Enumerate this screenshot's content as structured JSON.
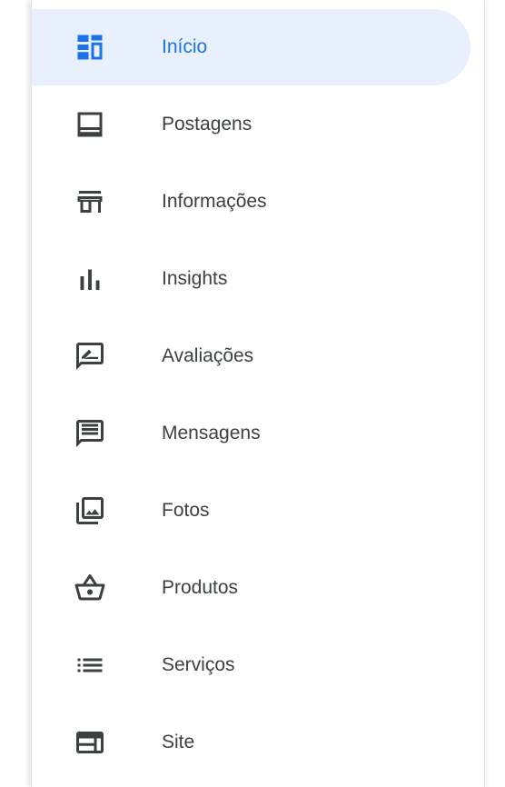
{
  "colors": {
    "accent": "#1a73e8",
    "active_background": "#e8f0fe",
    "text": "#3c4043"
  },
  "sidebar": {
    "active_index": 0,
    "items": [
      {
        "label": "Início",
        "icon": "dashboard-icon"
      },
      {
        "label": "Postagens",
        "icon": "posts-icon"
      },
      {
        "label": "Informações",
        "icon": "store-icon"
      },
      {
        "label": "Insights",
        "icon": "bar-chart-icon"
      },
      {
        "label": "Avaliações",
        "icon": "rate-review-icon"
      },
      {
        "label": "Mensagens",
        "icon": "message-icon"
      },
      {
        "label": "Fotos",
        "icon": "photo-library-icon"
      },
      {
        "label": "Produtos",
        "icon": "shopping-basket-icon"
      },
      {
        "label": "Serviços",
        "icon": "list-icon"
      },
      {
        "label": "Site",
        "icon": "web-icon"
      }
    ]
  }
}
